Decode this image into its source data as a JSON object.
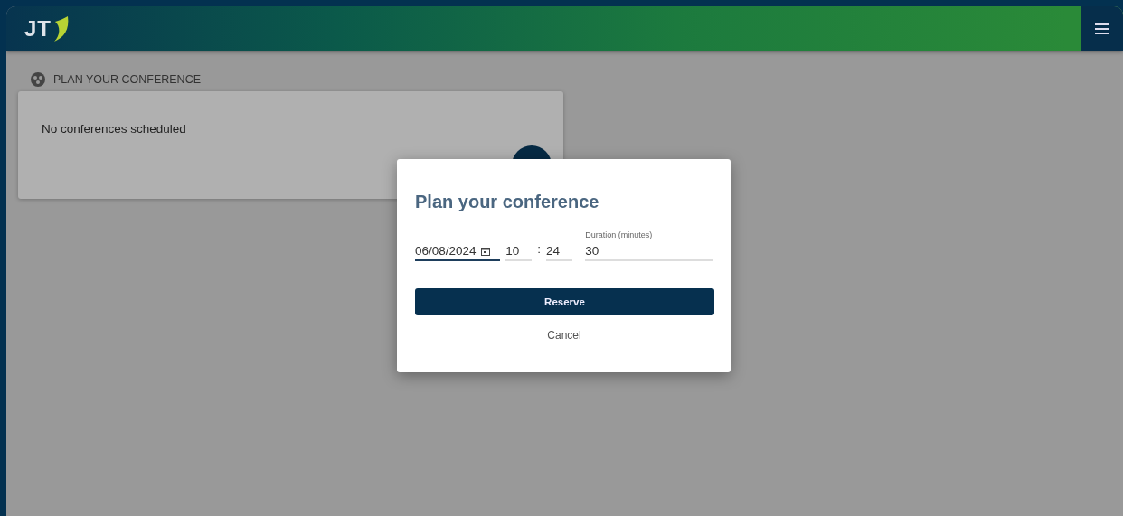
{
  "header": {
    "logo": "JT"
  },
  "section": {
    "title": "PLAN YOUR CONFERENCE",
    "empty_text": "No conferences scheduled"
  },
  "dialog": {
    "title": "Plan your conference",
    "fields": [
      {
        "kind": "date",
        "value": "06/08/2024",
        "focused": true
      },
      {
        "kind": "hour",
        "value": "10",
        "focused": false
      },
      {
        "kind": "minute",
        "value": "24",
        "separator": ":",
        "focused": false
      },
      {
        "kind": "duration",
        "label": "Duration (minutes)",
        "value": "30",
        "focused": false
      }
    ],
    "primary_button": "Reserve",
    "secondary_button": "Cancel"
  }
}
